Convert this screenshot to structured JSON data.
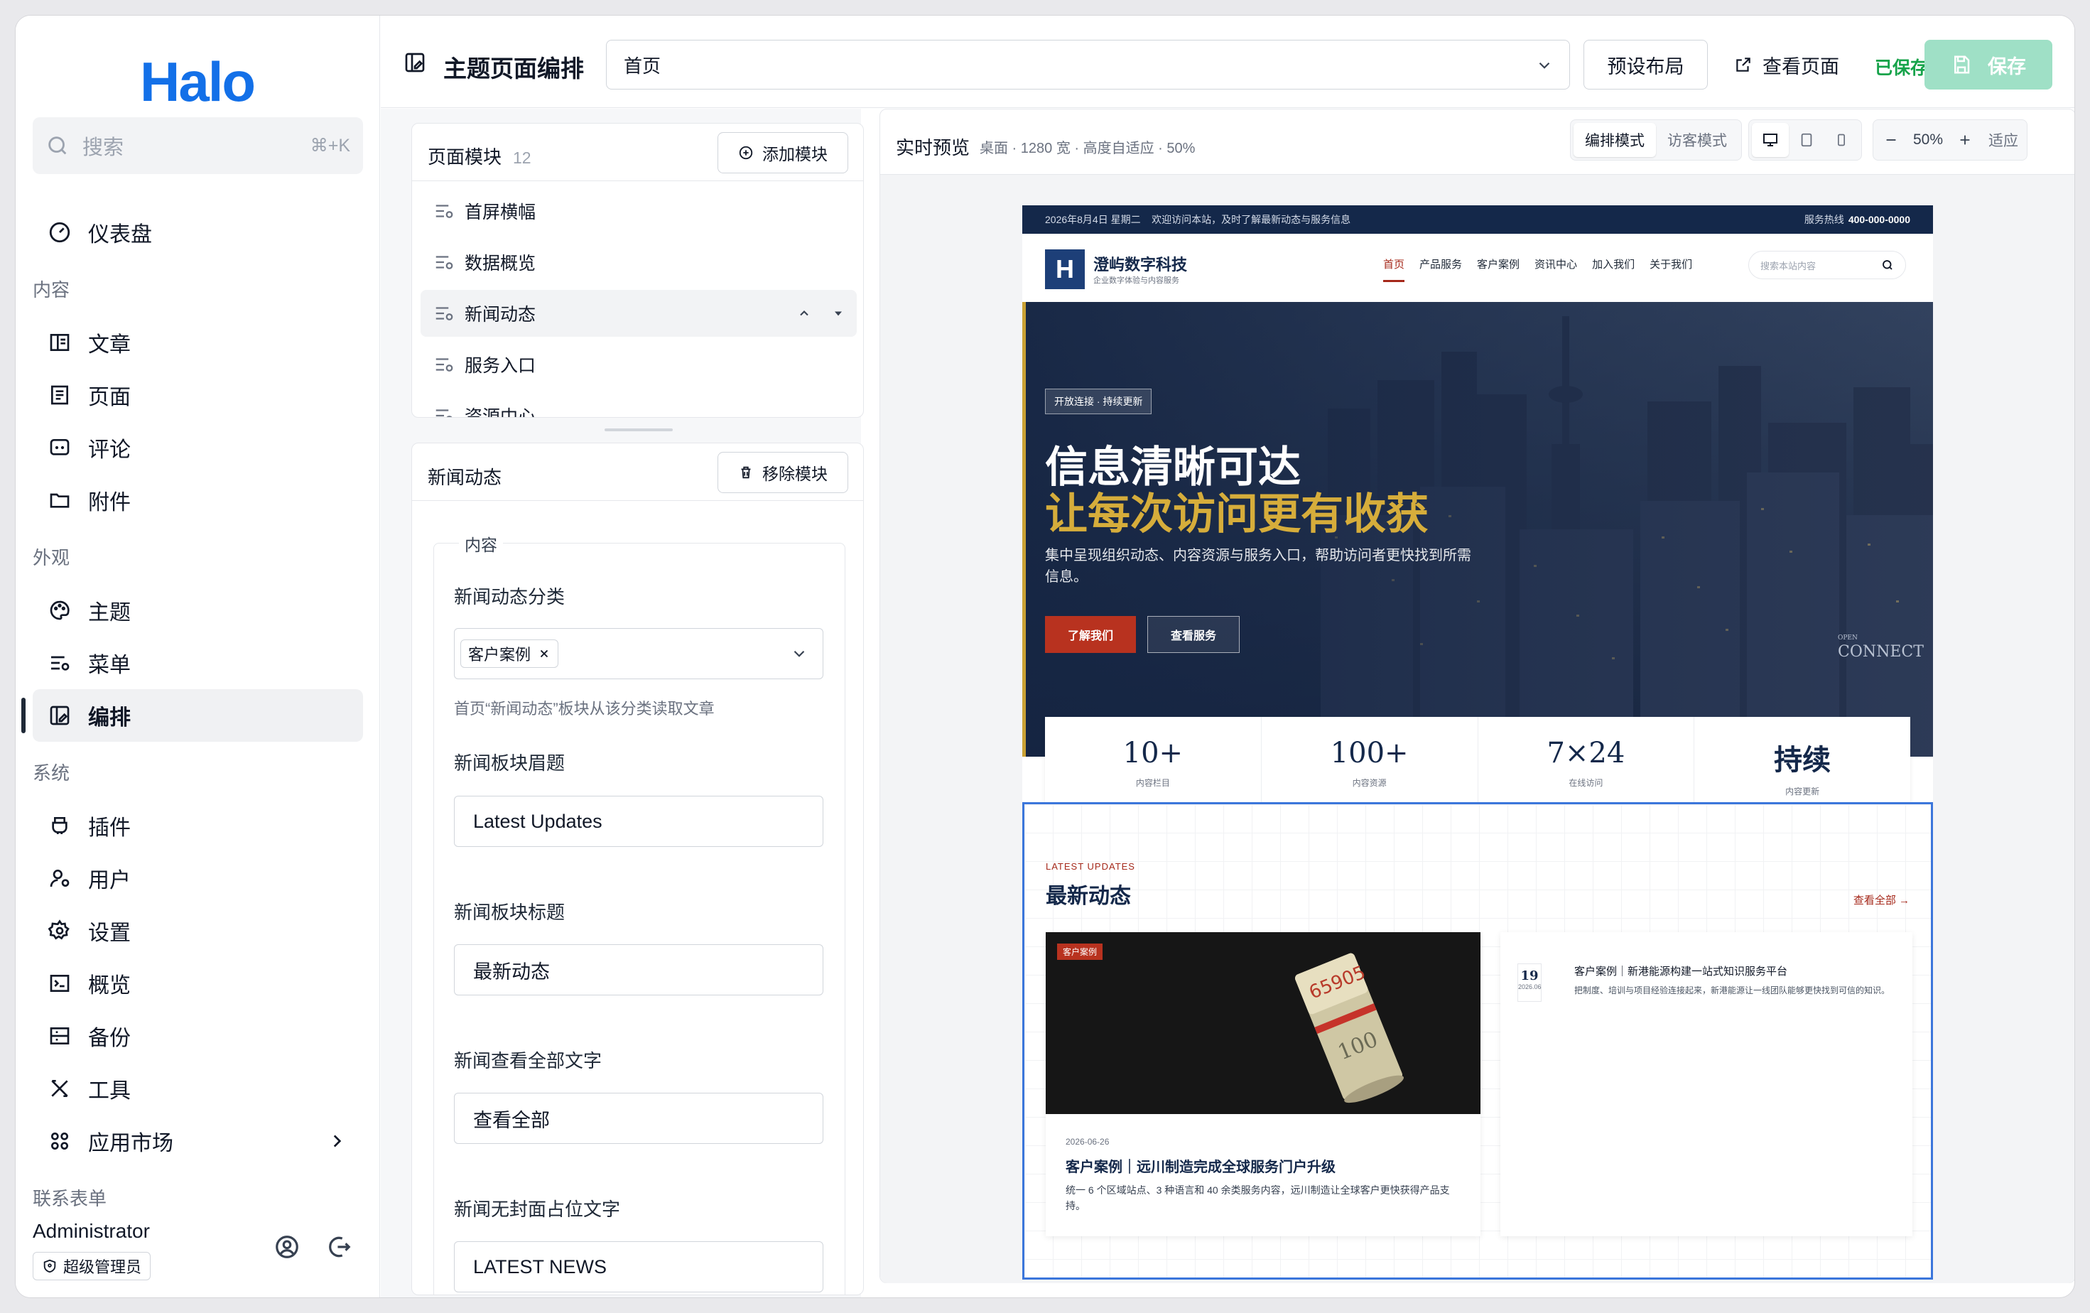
{
  "sidebar": {
    "logo": "Halo",
    "search": {
      "placeholder": "搜索",
      "shortcut": "⌘+K"
    },
    "dashboard": "仪表盘",
    "groups": {
      "content": "内容",
      "appearance": "外观",
      "system": "系统",
      "forms": "联系表单"
    },
    "content_items": [
      "文章",
      "页面",
      "评论",
      "附件"
    ],
    "appearance_items": [
      "主题",
      "菜单",
      "编排"
    ],
    "system_items": [
      "插件",
      "用户",
      "设置",
      "概览",
      "备份",
      "工具",
      "应用市场"
    ],
    "user": {
      "name": "Administrator",
      "role": "超级管理员"
    }
  },
  "topbar": {
    "title": "主题页面编排",
    "page_select": "首页",
    "preset_button": "预设布局",
    "view_button": "查看页面",
    "saved_status": "已保存",
    "save_button": "保存"
  },
  "modules": {
    "title": "页面模块",
    "count": "12",
    "add_button": "添加模块",
    "items": [
      "首屏横幅",
      "数据概览",
      "新闻动态",
      "服务入口",
      "资源中心"
    ],
    "selected_index": 2
  },
  "editor": {
    "title": "新闻动态",
    "remove_button": "移除模块",
    "legend": "内容",
    "category_label": "新闻动态分类",
    "category_tag": "客户案例",
    "category_help": "首页“新闻动态”板块从该分类读取文章",
    "eyebrow_label": "新闻板块眉题",
    "eyebrow_value": "Latest Updates",
    "title_label": "新闻板块标题",
    "title_value": "最新动态",
    "viewall_label": "新闻查看全部文字",
    "viewall_value": "查看全部",
    "placeholder_label": "新闻无封面占位文字",
    "placeholder_value": "LATEST NEWS"
  },
  "preview": {
    "title": "实时预览",
    "meta": "桌面 · 1280 宽 · 高度自适应 · 50%",
    "mode_edit": "编排模式",
    "mode_visitor": "访客模式",
    "zoom": "50%",
    "fit": "适应"
  },
  "site": {
    "topbar_left": "2026年8月4日 星期二    欢迎访问本站，及时了解最新动态与服务信息",
    "hotline_label": "服务热线",
    "hotline": "400-000-0000",
    "brand_logo": "H",
    "brand": "澄屿数字科技",
    "brand_sub": "企业数字体验与内容服务",
    "menu": [
      "首页",
      "产品服务",
      "客户案例",
      "资讯中心",
      "加入我们",
      "关于我们"
    ],
    "search_placeholder": "搜索本站内容",
    "hero": {
      "pill": "开放连接 · 持续更新",
      "title1": "信息清晰可达",
      "title2": "让每次访问更有收获",
      "desc": "集中呈现组织动态、内容资源与服务入口，帮助访问者更快找到所需信息。",
      "btn_primary": "了解我们",
      "btn_secondary": "查看服务",
      "sign_small": "OPEN",
      "sign": "CONNECT"
    },
    "stats": [
      {
        "value": "10+",
        "label": "内容栏目"
      },
      {
        "value": "100+",
        "label": "内容资源"
      },
      {
        "value": "7×24",
        "label": "在线访问"
      },
      {
        "value": "持续",
        "label": "内容更新"
      }
    ],
    "news": {
      "eyebrow": "LATEST UPDATES",
      "title": "最新动态",
      "view_all": "查看全部 →",
      "featured": {
        "badge": "客户案例",
        "date": "2026-06-26",
        "title": "客户案例｜远川制造完成全球服务门户升级",
        "excerpt": "统一 6 个区域站点、3 种语言和 40 余类服务内容，远川制造让全球客户更快获得产品支持。"
      },
      "side": {
        "day": "19",
        "month": "2026.06",
        "title": "客户案例｜新港能源构建一站式知识服务平台",
        "excerpt": "把制度、培训与项目经验连接起来，新港能源让一线团队能够更快找到可信的知识。"
      }
    }
  },
  "colors": {
    "brand_blue": "#1370e8",
    "navy": "#14284a",
    "accent_red": "#b8321f",
    "gold": "#d6ad3b",
    "saved_green": "#16a34a",
    "save_disabled": "#9fe0c6"
  }
}
